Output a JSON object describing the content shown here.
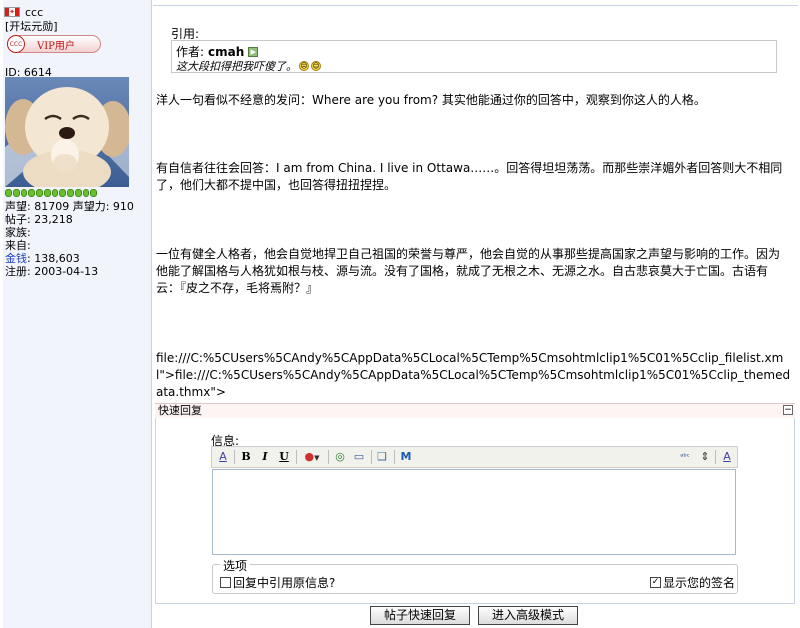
{
  "user": {
    "username": "ccc",
    "title": "[开坛元勋]",
    "vip_badge": "VIP用户",
    "vip_circle": "CCC",
    "id_label": "ID: 6614",
    "stats": [
      {
        "label": "声望: 81709 声望力: 910"
      },
      {
        "label": "帖子: 23,218"
      },
      {
        "label": "家族:"
      },
      {
        "label": "来自:"
      },
      {
        "key": "金钱",
        "value": ": 138,603"
      },
      {
        "label": "注册: 2003-04-13"
      }
    ],
    "level_pips": 12
  },
  "quote": {
    "label": "引用:",
    "author_prefix": "作者:",
    "author": "cmah",
    "text": "这大段扣得把我吓傻了。"
  },
  "post": {
    "paragraphs": [
      "洋人一句看似不经意的发问：Where are you from? 其实他能通过你的回答中，观察到你这人的人格。",
      "有自信者往往会回答：I am from China. I live in Ottawa……。回答得坦坦荡荡。而那些崇洋媚外者回答则大不相同了，他们大都不提中国，也回答得扭扭捏捏。",
      "一位有健全人格者，他会自觉地捍卫自己祖国的荣誉与尊严，他会自觉的从事那些提高国家之声望与影响的工作。因为他能了解国格与人格犹如根与枝、源与流。没有了国格，就成了无根之木、无源之水。自古悲哀莫大于亡国。古语有云：『皮之不存，毛将焉附？』",
      "file:///C:%5CUsers%5CAndy%5CAppData%5CLocal%5CTemp%5Cmsohtmlclip1%5C01%5Cclip_filelist.xml\">file:///C:%5CUsers%5CAndy%5CAppData%5CLocal%5CTemp%5Cmsohtmlclip1%5C01%5Cclip_themedata.thmx\">"
    ]
  },
  "quick_reply": {
    "header": "快速回复",
    "collapse": "−",
    "message_label": "信息:",
    "message_value": "",
    "toolbar": [
      {
        "icon": "format-icon",
        "glyph": "A"
      },
      {
        "icon": "bold-icon",
        "glyph": "B"
      },
      {
        "icon": "italic-icon",
        "glyph": "I"
      },
      {
        "icon": "underline-icon",
        "glyph": "U"
      },
      {
        "icon": "color-icon",
        "glyph": "●"
      },
      {
        "icon": "link-icon",
        "glyph": "◎"
      },
      {
        "icon": "image-icon",
        "glyph": "▭"
      },
      {
        "icon": "quote-icon",
        "glyph": "❑"
      },
      {
        "icon": "media-icon",
        "glyph": "M"
      },
      {
        "icon": "spellcheck-icon",
        "glyph": "ᵃᵇᶜ"
      },
      {
        "icon": "resize-icon",
        "glyph": "⇕"
      },
      {
        "icon": "font-size-icon",
        "glyph": "A"
      }
    ],
    "options_legend": "选项",
    "option_quote": "回复中引用原信息?",
    "option_quote_checked": false,
    "option_signature": "显示您的签名",
    "option_signature_checked": true,
    "submit_button": "帖子快速回复",
    "advanced_button": "进入高级模式"
  },
  "colors": {
    "sidebar_bg": "#f1f4fb",
    "link_blue": "#2040c0",
    "level_green": "#6bc030"
  }
}
